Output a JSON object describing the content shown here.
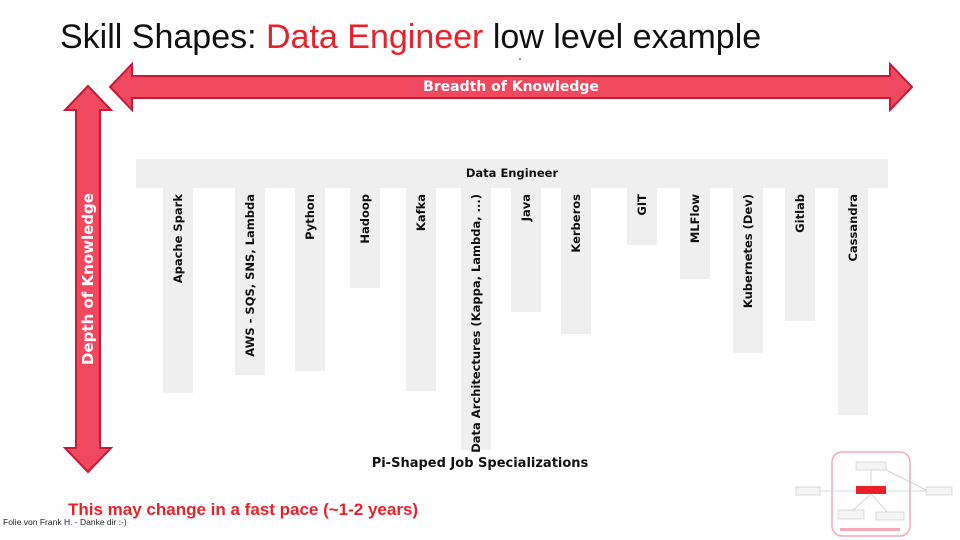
{
  "title": {
    "prefix": "Skill Shapes: ",
    "accent": "Data Engineer",
    "suffix": " low level example"
  },
  "breadth_label": "Breadth of Knowledge",
  "depth_label": "Depth of Knowledge",
  "role_label": "Data Engineer",
  "skills": [
    {
      "label": "Apache Spark",
      "depth": 205
    },
    {
      "label": "AWS - SQS, SNS, Lambda",
      "depth": 187
    },
    {
      "label": "Python",
      "depth": 183
    },
    {
      "label": "Hadoop",
      "depth": 100
    },
    {
      "label": "Kafka",
      "depth": 203
    },
    {
      "label": "Data Architectures (Kappa, Lambda, ...)",
      "depth": 262
    },
    {
      "label": "Java",
      "depth": 124
    },
    {
      "label": "Kerberos",
      "depth": 146
    },
    {
      "label": "GIT",
      "depth": 57
    },
    {
      "label": "MLFlow",
      "depth": 91
    },
    {
      "label": "Kubernetes (Dev)",
      "depth": 165
    },
    {
      "label": "Gitlab",
      "depth": 133
    },
    {
      "label": "Cassandra",
      "depth": 227
    }
  ],
  "footer_title": "Pi-Shaped Job Specializations",
  "note": "This may change in a fast pace (~1-2 years)",
  "credit": "Folie von Frank H. - Danke dir :-)",
  "colors": {
    "accent": "#e8212a",
    "arrow": "#f0485f",
    "arrow_outline": "#c41c37",
    "bar": "#efefef"
  }
}
